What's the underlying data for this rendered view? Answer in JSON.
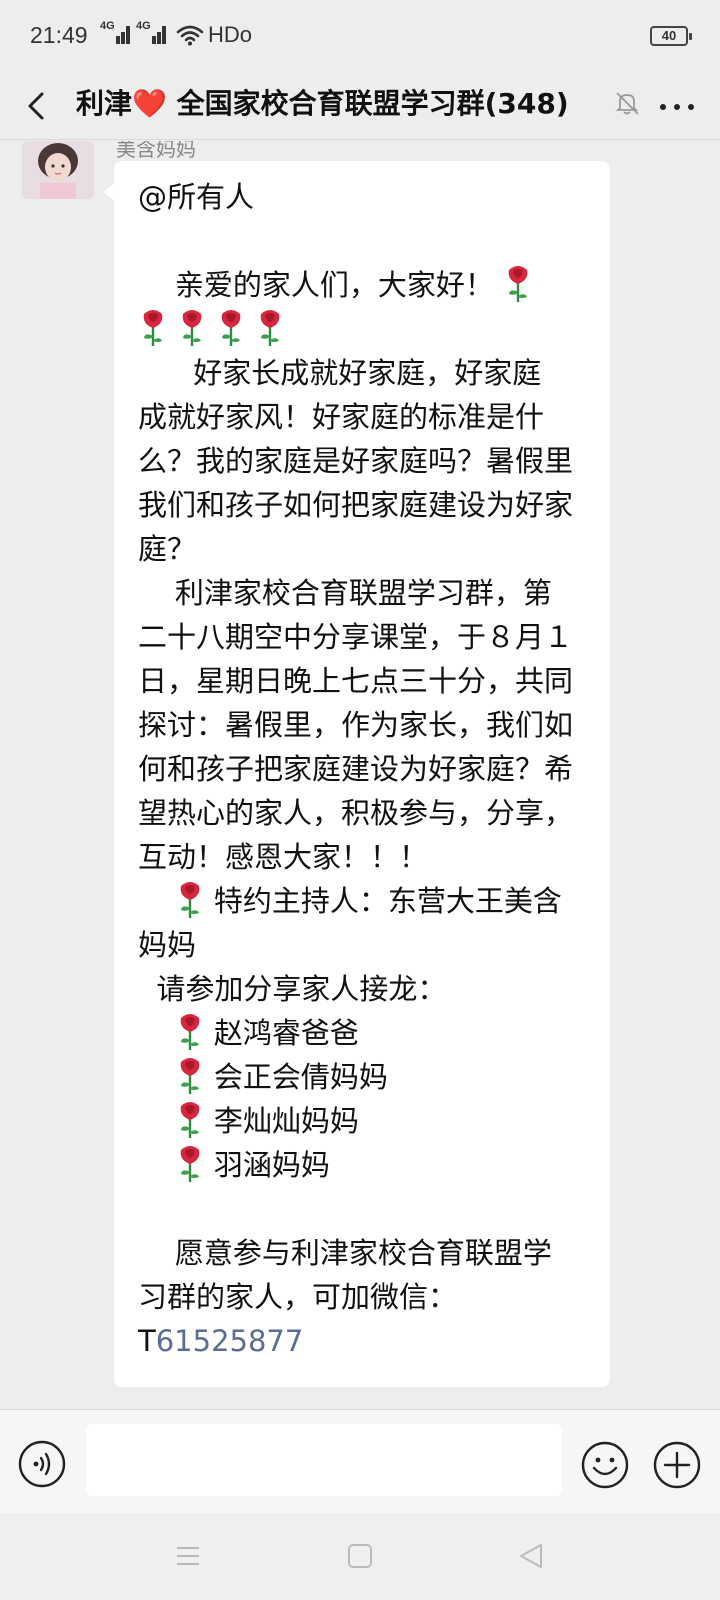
{
  "status_bar": {
    "time": "21:49",
    "network_1": "4G",
    "network_2": "4G",
    "hd_label": "HDo",
    "battery": "40"
  },
  "header": {
    "title_prefix": "利津",
    "title_heart": "❤️",
    "title_main": " 全国家校合育联盟学习群(348)",
    "back_icon": "chevron-left-icon",
    "mute_icon": "bell-off-icon",
    "more_icon": "more-dots-icon"
  },
  "message": {
    "sender": "美含妈妈",
    "lines": [
      {
        "text": "@所有人",
        "roses": 0
      },
      {
        "text": "",
        "roses": 0
      },
      {
        "text": "    亲爱的家人们，大家好！ ",
        "roses": 1
      },
      {
        "text": "",
        "roses": 4
      },
      {
        "text": "      好家长成就好家庭，好家庭",
        "roses": 0
      },
      {
        "text": "成就好家风！好家庭的标准是什",
        "roses": 0
      },
      {
        "text": "么？我的家庭是好家庭吗？暑假里",
        "roses": 0
      },
      {
        "text": "我们和孩子如何把家庭建设为好家",
        "roses": 0
      },
      {
        "text": "庭？",
        "roses": 0
      },
      {
        "text": "    利津家校合育联盟学习群，第",
        "roses": 0
      },
      {
        "text": "二十八期空中分享课堂，于８月１",
        "roses": 0
      },
      {
        "text": "日，星期日晚上七点三十分，共同",
        "roses": 0
      },
      {
        "text": "探讨：暑假里，作为家长，我们如",
        "roses": 0
      },
      {
        "text": "何和孩子把家庭建设为好家庭？希",
        "roses": 0
      },
      {
        "text": "望热心的家人，积极参与，分享，",
        "roses": 0
      },
      {
        "text": "互动！感恩大家！！！",
        "roses": 0
      },
      {
        "text": "特约主持人：东营大王美含",
        "roses": 1,
        "prefix": "    "
      },
      {
        "text": "妈妈",
        "roses": 0
      },
      {
        "text": "  请参加分享家人接龙：",
        "roses": 0
      },
      {
        "text": "赵鸿睿爸爸",
        "roses": 1,
        "prefix": "    "
      },
      {
        "text": "会正会倩妈妈",
        "roses": 1,
        "prefix": "    "
      },
      {
        "text": "李灿灿妈妈",
        "roses": 1,
        "prefix": "    "
      },
      {
        "text": "羽涵妈妈",
        "roses": 1,
        "prefix": "    "
      },
      {
        "text": "",
        "roses": 0
      },
      {
        "text": "    愿意参与利津家校合育联盟学",
        "roses": 0
      },
      {
        "text": "习群的家人，可加微信：",
        "roses": 0
      }
    ],
    "wechat_prefix": "T",
    "wechat_id": "61525877"
  },
  "input_bar": {
    "voice_icon": "voice-icon",
    "emoji_icon": "emoji-icon",
    "plus_icon": "plus-circle-icon",
    "input_value": ""
  },
  "nav_bar": {
    "menu_icon": "menu-icon",
    "home_icon": "home-square-icon",
    "back_icon": "back-triangle-icon"
  },
  "colors": {
    "background": "#ededed",
    "bubble": "#ffffff",
    "link": "#5a6e93",
    "heart": "#e0303a"
  }
}
